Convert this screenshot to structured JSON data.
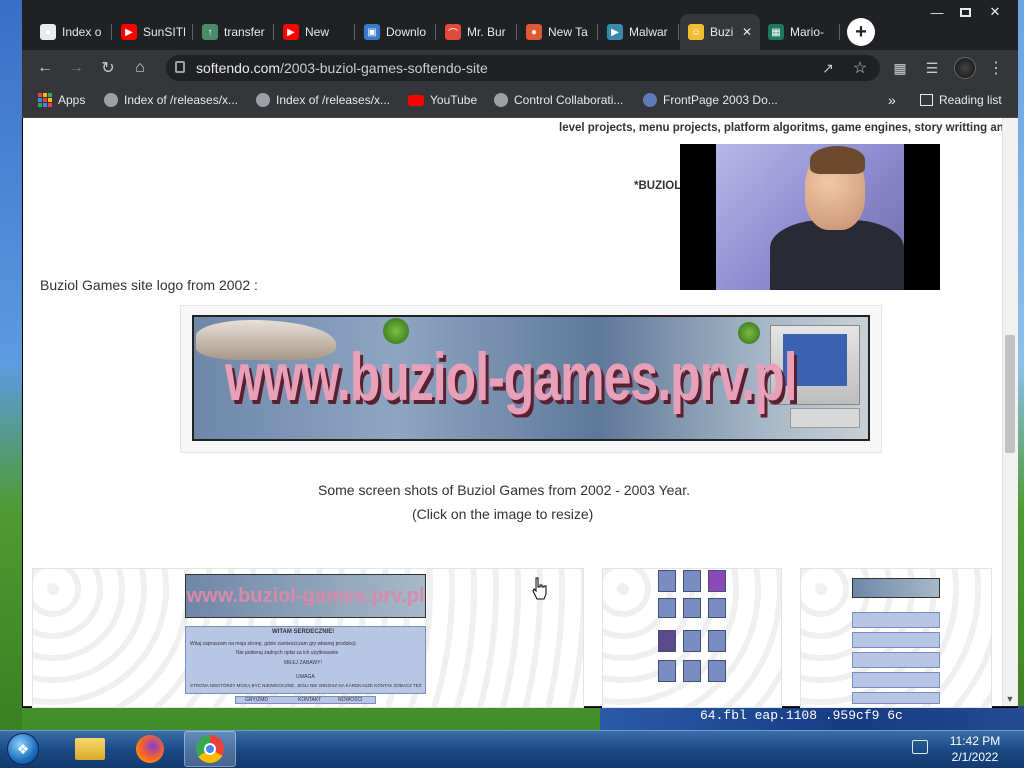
{
  "tabs": [
    {
      "title": "Index o",
      "icon": "github-icon",
      "color": "#e8eaed",
      "active": false
    },
    {
      "title": "SunSITE",
      "icon": "youtube-icon",
      "color": "#ff0000",
      "active": false
    },
    {
      "title": "transfer",
      "icon": "upload-icon",
      "color": "#4a8a6a",
      "active": false
    },
    {
      "title": "New",
      "icon": "youtube-icon",
      "color": "#ff0000",
      "active": false
    },
    {
      "title": "Downlo",
      "icon": "picture-icon",
      "color": "#3a7ac8",
      "active": false
    },
    {
      "title": "Mr. Bur",
      "icon": "rainbow-icon",
      "color": "#e04a3a",
      "active": false
    },
    {
      "title": "New Ta",
      "icon": "duckduckgo-icon",
      "color": "#de5833",
      "active": false
    },
    {
      "title": "Malwar",
      "icon": "play-icon",
      "color": "#3a8ab0",
      "active": false
    },
    {
      "title": "Buzi",
      "icon": "character-icon",
      "color": "#f0c030",
      "active": true
    },
    {
      "title": "Mario-",
      "icon": "cube-icon",
      "color": "#1a7a5a",
      "active": false
    }
  ],
  "address": {
    "host": "softendo.com",
    "path": "/2003-buziol-games-softendo-site"
  },
  "bookmarks": {
    "apps": "Apps",
    "items": [
      "Index of /releases/x...",
      "Index of /releases/x...",
      "YouTube",
      "Control Collaborati...",
      "FrontPage 2003 Do..."
    ],
    "overflow": "»",
    "reading_list": "Reading list"
  },
  "page": {
    "top_text": "level projects, menu projects, platform algoritms, game engines, story writting and",
    "partial_text": "*BUZIOL",
    "logo_caption": "Buziol Games site logo from 2002 :",
    "banner_text": "www.buziol-games.prv.pl",
    "screens_caption_1": "Some screen shots of Buziol Games from 2002 - 2003 Year.",
    "screens_caption_2": "(Click on the image to resize)",
    "thumb1": {
      "banner": "www.buziol-games.prv.pl",
      "heading": "WITAM SERDECZNIE!",
      "line_1": "Witaj zapraszam na moja stronę, gdzie zamieszczam gry własnej produkcji.",
      "line_2": "Nie pobieraj żadnych opłat za ich użytkowanie",
      "section": "MIŁEJ ZABAWY!",
      "warning_label": "UWAGA",
      "warning_text": "STRONA NIEKTÓRZY MOGĄ BYĆ NIEWIDOCZNE. JEŚLI NIE WIDZISZ NA KARDKASZE KONTAK ZOBACZ TEŻ",
      "links": [
        "GRY/ZMD",
        "KONTAKT",
        "NOWOŚCI"
      ]
    }
  },
  "desktop": {
    "partial_filename": "64.fbl  eap.1108  .959cf9  6c"
  },
  "clock": {
    "time": "11:42 PM",
    "date": "2/1/2022"
  }
}
